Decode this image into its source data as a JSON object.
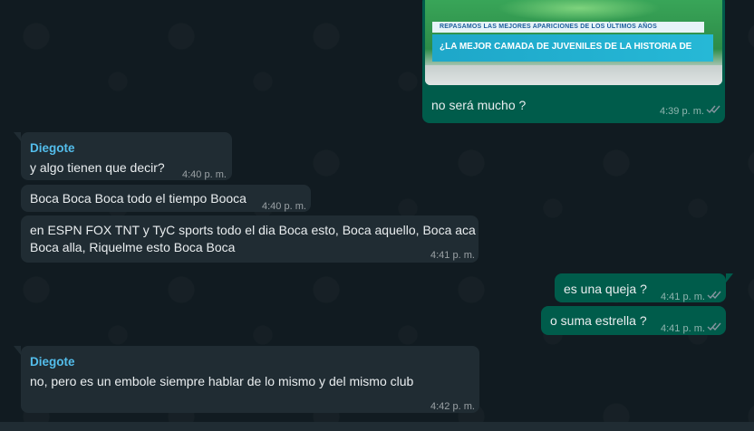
{
  "messages": [
    {
      "id": "m0",
      "dir": "out",
      "type": "image",
      "image_banner_top": "REPASAMOS LAS MEJORES APARICIONES DE LOS ÚLTIMOS AÑOS",
      "image_banner_main": "¿LA MEJOR CAMADA DE JUVENILES DE LA HISTORIA DE BOCA?",
      "caption": "no será mucho ?",
      "time": "4:39 p. m.",
      "status": "read"
    },
    {
      "id": "m1",
      "dir": "in",
      "sender": "Diegote",
      "text": "y algo tienen que decir?",
      "time": "4:40 p. m."
    },
    {
      "id": "m2",
      "dir": "in",
      "text": "Boca Boca Boca todo el tiempo Booca",
      "time": "4:40 p. m."
    },
    {
      "id": "m3",
      "dir": "in",
      "text_line1": "en ESPN FOX TNT y TyC sports todo el dia Boca esto, Boca aquello, Boca aca",
      "text_line2": "Boca alla, Riquelme esto Boca Boca",
      "time": "4:41 p. m."
    },
    {
      "id": "m4",
      "dir": "out",
      "text": "es una queja ?",
      "time": "4:41 p. m.",
      "status": "read"
    },
    {
      "id": "m5",
      "dir": "out",
      "text": "o suma estrella ?",
      "time": "4:41 p. m.",
      "status": "read"
    },
    {
      "id": "m6",
      "dir": "in",
      "sender": "Diegote",
      "text": "no, pero es un embole siempre hablar de lo mismo y del mismo club",
      "time": "4:42 p. m."
    }
  ],
  "colors": {
    "incoming": "#202c33",
    "outgoing": "#005c4b",
    "sender": "#53bdeb",
    "background": "#111b21"
  },
  "icons": {
    "read_receipt": "double-check-icon"
  }
}
